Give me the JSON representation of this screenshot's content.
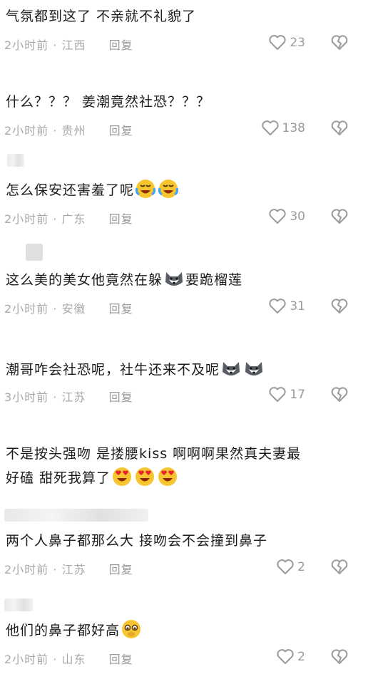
{
  "comments": [
    {
      "text": "气氛都到这了 不亲就不礼貌了",
      "time": "2小时前",
      "loc": "江西",
      "reply": "回复",
      "likes": "23"
    },
    {
      "text": "什么？？？ 姜潮竟然社恐？？？",
      "time": "2小时前",
      "loc": "贵州",
      "reply": "回复",
      "likes": "138"
    },
    {
      "text": "怎么保安还害羞了呢",
      "time": "2小时前",
      "loc": "广东",
      "reply": "回复",
      "likes": "30"
    },
    {
      "text": "这么美的美女他竟然在躲",
      "text2": "要跪榴莲",
      "time": "2小时前",
      "loc": "安徽",
      "reply": "回复",
      "likes": "31"
    },
    {
      "text": "潮哥咋会社恐呢，社牛还来不及呢",
      "time": "3小时前",
      "loc": "江苏",
      "reply": "回复",
      "likes": "17"
    },
    {
      "text": "不是按头强吻 是搂腰kiss 啊啊啊果然真夫妻最",
      "text2": "好磕 甜死我算了",
      "likes": ""
    },
    {
      "text": "两个人鼻子都那么大  接吻会不会撞到鼻子",
      "time": "2小时前",
      "loc": "江苏",
      "reply": "回复",
      "likes": "2"
    },
    {
      "text": "他们的鼻子都好高",
      "time": "2小时前",
      "loc": "山东",
      "reply": "回复",
      "likes": "2"
    }
  ],
  "sep": "·",
  "icons": {
    "like": "heart-outline-icon",
    "dislike": "broken-heart-icon"
  },
  "colors": {
    "icon": "#9a9a9a",
    "text": "#1b1b1b",
    "meta": "#a9a9a9"
  }
}
